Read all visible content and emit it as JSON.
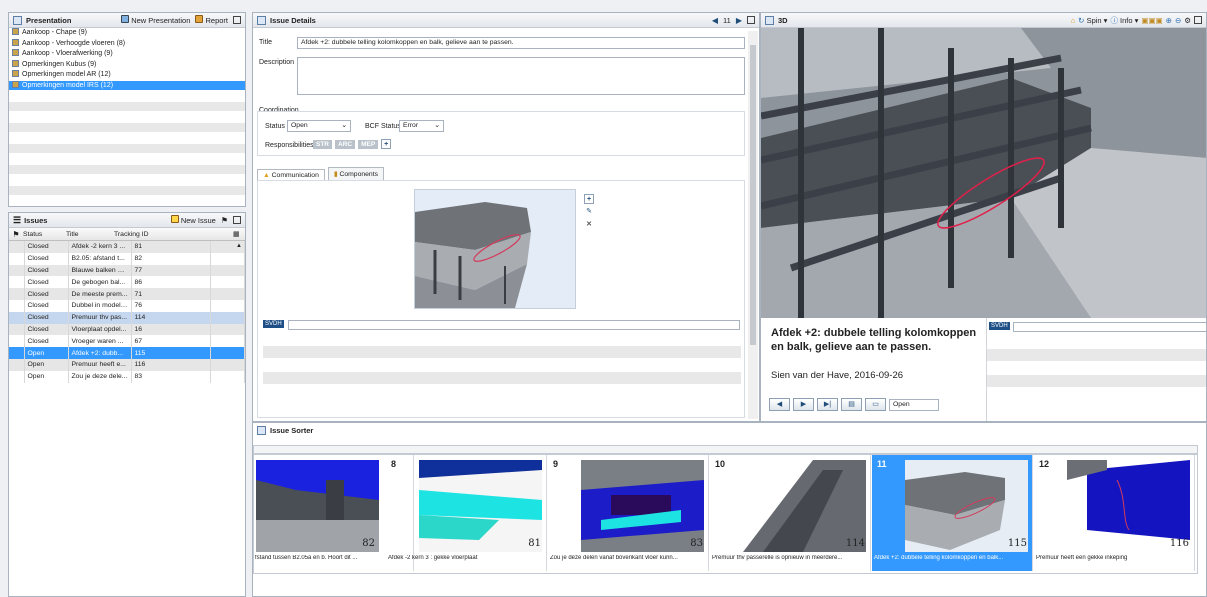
{
  "presentation": {
    "title": "Presentation",
    "new_label": "New Presentation",
    "report_label": "Report",
    "items": [
      {
        "label": "Aankoop - Chape (9)"
      },
      {
        "label": "Aankoop - Verhoogde vloeren (8)"
      },
      {
        "label": "Aankoop - Vloerafwerking (9)"
      },
      {
        "label": "Opmerkingen Kubus (9)"
      },
      {
        "label": "Opmerkingen model AR (12)"
      },
      {
        "label": "Opmerkingen model IRS (12)"
      }
    ]
  },
  "issues": {
    "title": "Issues",
    "new_label": "New Issue",
    "columns": {
      "status": "Status",
      "title": "Title",
      "tracking": "Tracking ID"
    },
    "rows": [
      {
        "status": "Closed",
        "title": "Afdek -2 kern 3 ...",
        "id": "81"
      },
      {
        "status": "Closed",
        "title": "B2.05: afstand t...",
        "id": "82"
      },
      {
        "status": "Closed",
        "title": "Blauwe balken zi...",
        "id": "77"
      },
      {
        "status": "Closed",
        "title": "De gebogen bal...",
        "id": "86"
      },
      {
        "status": "Closed",
        "title": "De meeste prem...",
        "id": "71"
      },
      {
        "status": "Closed",
        "title": "Dubbel in model:...",
        "id": "76"
      },
      {
        "status": "Closed",
        "title": "Premuur thv pas...",
        "id": "114"
      },
      {
        "status": "Closed",
        "title": "Vloerplaat opdel...",
        "id": "16"
      },
      {
        "status": "Closed",
        "title": "Vroeger waren ...",
        "id": "67"
      },
      {
        "status": "Open",
        "title": "Afdek +2: dubb...",
        "id": "115"
      },
      {
        "status": "Open",
        "title": "Premuur heeft e...",
        "id": "116"
      },
      {
        "status": "Open",
        "title": "Zou je deze dele...",
        "id": "83"
      }
    ]
  },
  "details": {
    "title": "Issue Details",
    "nav_index": "11",
    "title_label": "Title",
    "title_value": "Afdek +2: dubbele telling kolomkoppen en balk, gelieve aan te passen.",
    "description_label": "Description",
    "coordination_label": "Coordination",
    "status_label": "Status",
    "status_value": "Open",
    "bcf_label": "BCF Status",
    "bcf_value": "Error",
    "responsibilities_label": "Responsibilities",
    "chips": [
      "STR",
      "ARC",
      "MEP"
    ],
    "tabs": [
      "Communication",
      "Components"
    ],
    "comment_user": "SVDH"
  },
  "viewer": {
    "title": "3D",
    "spin_label": "Spin",
    "info_label": "Info",
    "caption_title": "Afdek +2: dubbele telling kolomkoppen en balk, gelieve aan te passen.",
    "caption_author": "Sien van der Have, 2016-09-26",
    "status_value": "Open",
    "comment_user": "SVDH"
  },
  "sorter": {
    "title": "Issue Sorter",
    "items": [
      {
        "num": "",
        "tracking": "82",
        "caption": "fstand tussen B2.05a en b. Hoort dit ..."
      },
      {
        "num": "8",
        "tracking": "81",
        "caption": "Afdek -2 kern 3 : gekke vloerplaat"
      },
      {
        "num": "9",
        "tracking": "83",
        "caption": "Zou je deze delen vanaf bovenkant vloer kunn..."
      },
      {
        "num": "10",
        "tracking": "114",
        "caption": "Premuur thv passerelle is opnieuw in meerdere..."
      },
      {
        "num": "11",
        "tracking": "115",
        "caption": "Afdek +2: dubbele telling kolomkoppen en balk..."
      },
      {
        "num": "12",
        "tracking": "116",
        "caption": "Premuur heeft een gekke inkeping"
      }
    ]
  }
}
